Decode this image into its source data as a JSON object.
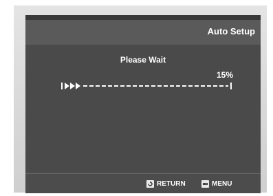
{
  "header": {
    "title": "Auto Setup"
  },
  "main": {
    "message": "Please Wait",
    "progress_text": "15%",
    "progress_fraction": 0.15
  },
  "footer": {
    "return": {
      "label": "RETURN",
      "icon": "return-icon"
    },
    "menu": {
      "label": "MENU",
      "icon": "menu-icon"
    }
  },
  "colors": {
    "screen_bg": "#4b4b4b",
    "header_bg": "#5a5a5a",
    "text": "#ffffff"
  }
}
